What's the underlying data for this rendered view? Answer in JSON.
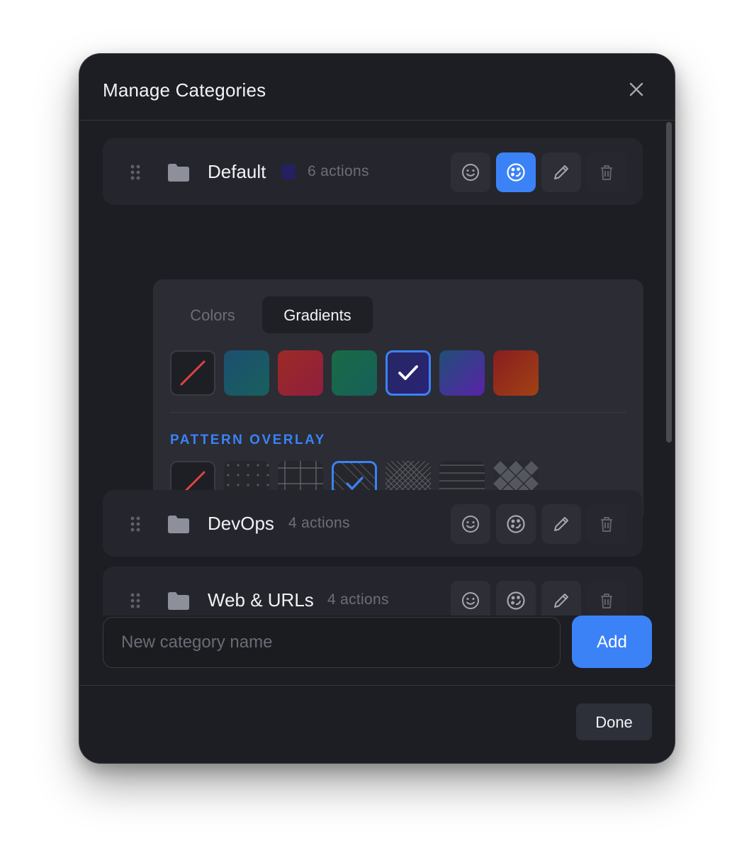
{
  "dialog": {
    "title": "Manage Categories",
    "close_icon": "close-icon"
  },
  "categories": [
    {
      "name": "Default",
      "count": "6 actions",
      "color": "#232160",
      "expanded": true,
      "active_action": "color-palette"
    },
    {
      "name": "DevOps",
      "count": "4 actions"
    },
    {
      "name": "Web & URLs",
      "count": "4 actions"
    }
  ],
  "row_actions": [
    "emoji-icon",
    "palette-icon",
    "pencil-icon",
    "trash-icon"
  ],
  "picker": {
    "tabs": [
      "Colors",
      "Gradients"
    ],
    "active_tab": "Gradients",
    "gradients": [
      {
        "id": "none"
      },
      {
        "id": "teal-blue",
        "from": "#1c4f70",
        "to": "#18605e"
      },
      {
        "id": "red-rose",
        "from": "#9c2a25",
        "to": "#8f1f3e"
      },
      {
        "id": "green-teal",
        "from": "#1a6a45",
        "to": "#16605a"
      },
      {
        "id": "navy-indigo",
        "from": "#262763",
        "to": "#2a2376",
        "selected": true
      },
      {
        "id": "indigo-purple",
        "from": "#1f4f78",
        "to": "#5a22a8"
      },
      {
        "id": "red-orange",
        "from": "#8a1d20",
        "to": "#a04214"
      }
    ],
    "pattern_label": "PATTERN OVERLAY",
    "patterns": [
      {
        "id": "none"
      },
      {
        "id": "dots"
      },
      {
        "id": "grid"
      },
      {
        "id": "diagonal",
        "selected": true
      },
      {
        "id": "crosshatch"
      },
      {
        "id": "horizontal-lines"
      },
      {
        "id": "checker"
      }
    ]
  },
  "new_category": {
    "placeholder": "New category name",
    "value": ""
  },
  "buttons": {
    "add": "Add",
    "done": "Done"
  },
  "colors": {
    "accent": "#3b82f6",
    "background": "#1d1e23",
    "row": "#25262d",
    "panel": "#2b2c34"
  }
}
